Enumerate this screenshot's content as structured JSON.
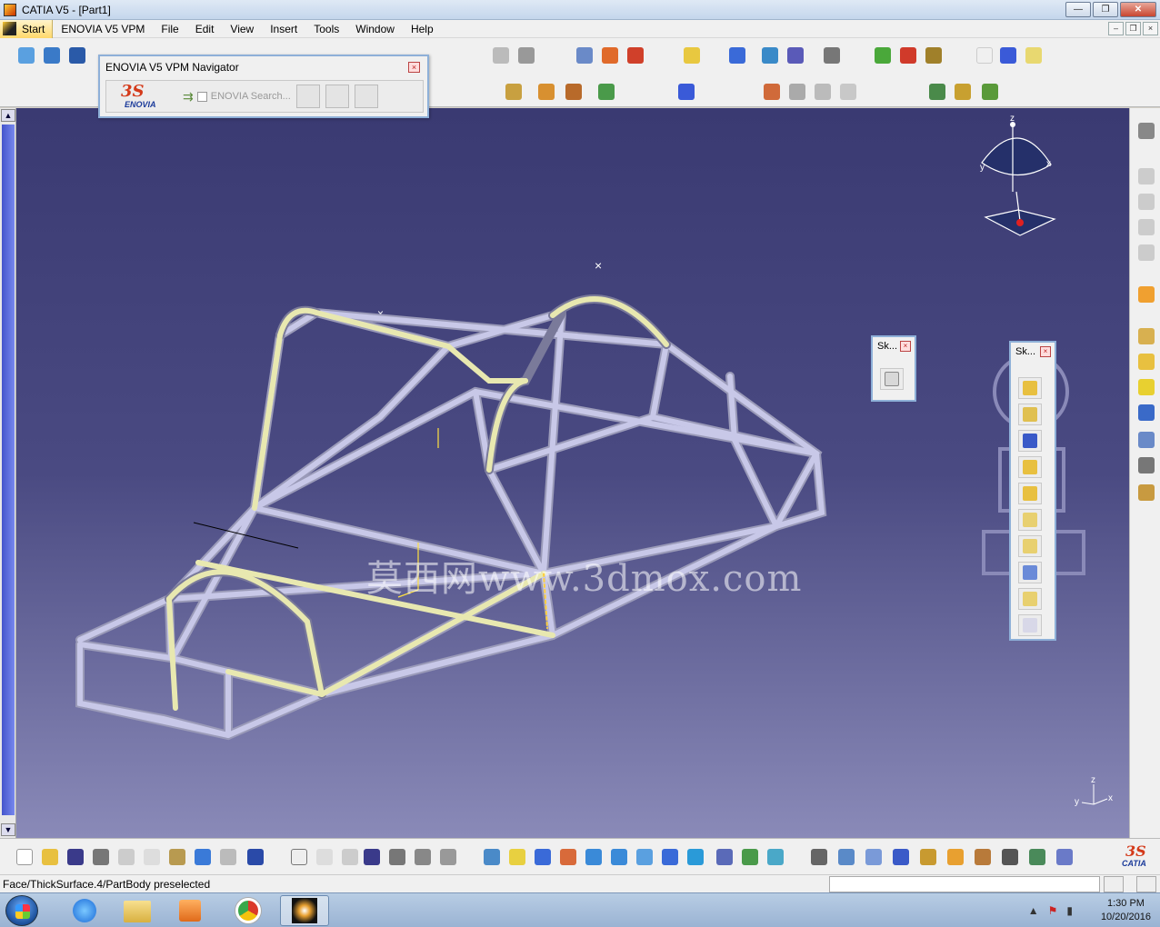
{
  "window": {
    "title": "CATIA V5 - [Part1]",
    "minimize": "—",
    "maximize": "❐",
    "close": "✕"
  },
  "menubar": {
    "start": "Start",
    "items": [
      "ENOVIA V5 VPM",
      "File",
      "Edit",
      "View",
      "Insert",
      "Tools",
      "Window",
      "Help"
    ],
    "mdi_buttons": [
      "–",
      "❐",
      "×"
    ]
  },
  "navigator": {
    "title": "ENOVIA V5 VPM Navigator",
    "close": "×",
    "logo_ds": "3S",
    "logo_text": "ENOVIA",
    "search_label": "ENOVIA Search..."
  },
  "sketch_panel_small": {
    "title": "Sk...",
    "close": "×"
  },
  "sketch_panel_large": {
    "title": "Sk...",
    "close": "×"
  },
  "compass_labels": {
    "z": "z",
    "x": "x",
    "y": "y"
  },
  "axis_labels": {
    "z": "z",
    "x": "x",
    "y": "y"
  },
  "watermark": "莫西网www.3dmox.com",
  "status": {
    "message": "Face/ThickSurface.4/PartBody preselected"
  },
  "catia_logo": {
    "ds": "3S",
    "text": "CATIA"
  },
  "taskbar": {
    "time": "1:30 PM",
    "date": "10/20/2016"
  },
  "colors": {
    "viewport_top": "#3a3a72",
    "viewport_bottom": "#8a8ab8",
    "tube_main": "#c8c8e8",
    "tube_highlight": "#e8e8b0",
    "accent": "#8eb0d8"
  }
}
